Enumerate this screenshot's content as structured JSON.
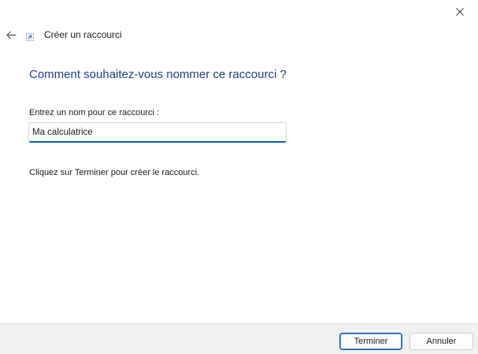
{
  "window": {
    "title": "Créer un raccourci",
    "close_icon": "close-icon",
    "back_icon": "back-arrow-icon",
    "title_icon": "shortcut-icon"
  },
  "main": {
    "heading": "Comment souhaitez-vous nommer ce raccourci ?",
    "field_label": "Entrez un nom pour ce raccourci :",
    "field_value": "Ma calculatrice",
    "hint": "Cliquez sur Terminer pour créer le raccourci."
  },
  "footer": {
    "finish_label": "Terminer",
    "cancel_label": "Annuler"
  },
  "colors": {
    "heading": "#1f3f8a",
    "accent": "#0f5fb0",
    "footer_bg": "#f0f0f0"
  }
}
